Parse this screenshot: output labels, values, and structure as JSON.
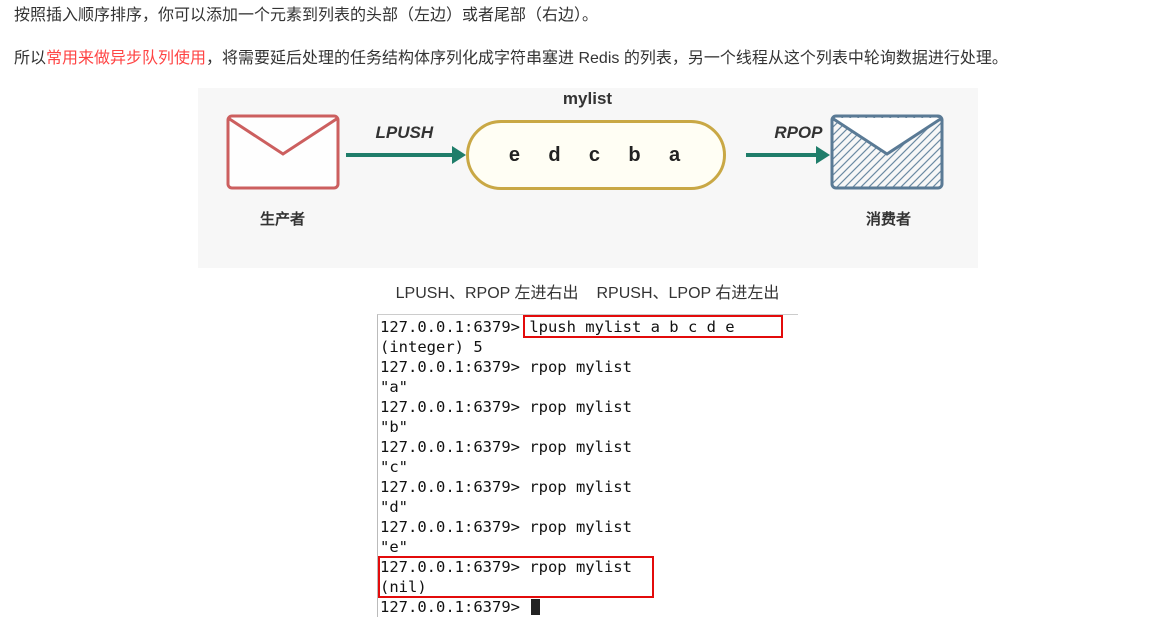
{
  "para1": "按照插入顺序排序，你可以添加一个元素到列表的头部（左边）或者尾部（右边）。",
  "para2_a": "所以",
  "para2_red": "常用来做异步队列使用",
  "para2_b": "，将需要延后处理的任务结构体序列化成字符串塞进 Redis 的列表，另一个线程从这个列表中轮询数据进行处理。",
  "diagram": {
    "producer": "生产者",
    "consumer": "消费者",
    "lpush": "LPUSH",
    "rpop": "RPOP",
    "list_title": "mylist",
    "items": [
      "e",
      "d",
      "c",
      "b",
      "a"
    ]
  },
  "caption_left": "LPUSH、RPOP 左进右出",
  "caption_right": "RPUSH、LPOP 右进左出",
  "terminal": {
    "p": "127.0.0.1:6379>",
    "lpush_cmd": " lpush mylist a b c d e ",
    "int_line": "(integer) 5",
    "rpop_cmd": " rpop mylist",
    "r1": "\"a\"",
    "r2": "\"b\"",
    "r3": "\"c\"",
    "r4": "\"d\"",
    "r5": "\"e\"",
    "nil": "(nil)"
  }
}
